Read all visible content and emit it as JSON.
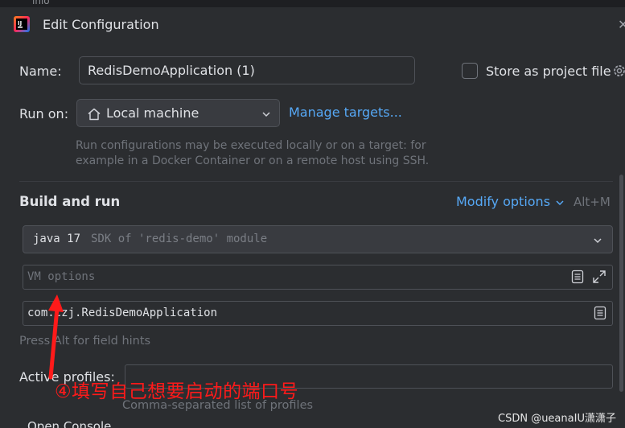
{
  "window": {
    "title": "Edit Configuration"
  },
  "background_fragment": "inio",
  "name_field": {
    "label": "Name:",
    "value": "RedisDemoApplication (1)"
  },
  "store_project_file": {
    "label": "Store as project file",
    "checked": false
  },
  "run_on": {
    "label": "Run on:",
    "selected": "Local machine",
    "manage_link": "Manage targets..."
  },
  "run_hint": {
    "line1": "Run configurations may be executed locally or on a target: for",
    "line2": "example in a Docker Container or on a remote host using SSH."
  },
  "build_run": {
    "title": "Build and run",
    "modify_options": "Modify options",
    "shortcut": "Alt+M"
  },
  "sdk": {
    "version": "java 17",
    "description": "SDK of 'redis-demo' module"
  },
  "vm_options": {
    "placeholder": "VM options",
    "value": ""
  },
  "main_class": {
    "value": "com.czj.RedisDemoApplication"
  },
  "field_hints": "Press Alt for field hints",
  "active_profiles": {
    "label": "Active profiles:",
    "value": "",
    "hint": "Comma-separated list of profiles"
  },
  "open_console": "Open Console",
  "annotation": {
    "text": "④填写自己想要启动的端口号",
    "color": "#ff1a1a"
  },
  "watermark": "CSDN @ueanaIU潇潇子",
  "colors": {
    "accent_link": "#56a8f5",
    "panel": "#2b2d30",
    "control": "#393b40",
    "border": "#4e5157"
  },
  "icons": [
    "intellij-app-icon",
    "close-icon",
    "gear-icon",
    "home-icon",
    "chevron-down-icon",
    "document-icon",
    "expand-icon"
  ]
}
